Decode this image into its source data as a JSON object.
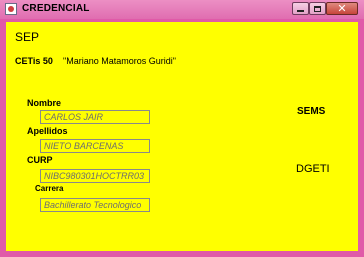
{
  "window": {
    "title": "CREDENCIAL",
    "close_glyph": "✕"
  },
  "header": {
    "sep": "SEP",
    "cetis": "CETis 50",
    "school_name": "\"Mariano Matamoros Guridi\""
  },
  "form": {
    "nombre_label": "Nombre",
    "nombre_value": "CARLOS JAIR",
    "apellidos_label": "Apellidos",
    "apellidos_value": "NIETO BARCENAS",
    "curp_label": "CURP",
    "curp_value": "NIBC980301HOCTRR03",
    "carrera_label": "Carrera",
    "carrera_value": "Bachillerato Tecnologico"
  },
  "side": {
    "sems": "SEMS",
    "dgeti": "DGETI"
  },
  "colors": {
    "background": "#ffff00",
    "titlebar": "#e06db0"
  },
  "icons": [
    "app-icon",
    "minimize-icon",
    "maximize-icon",
    "close-icon"
  ]
}
